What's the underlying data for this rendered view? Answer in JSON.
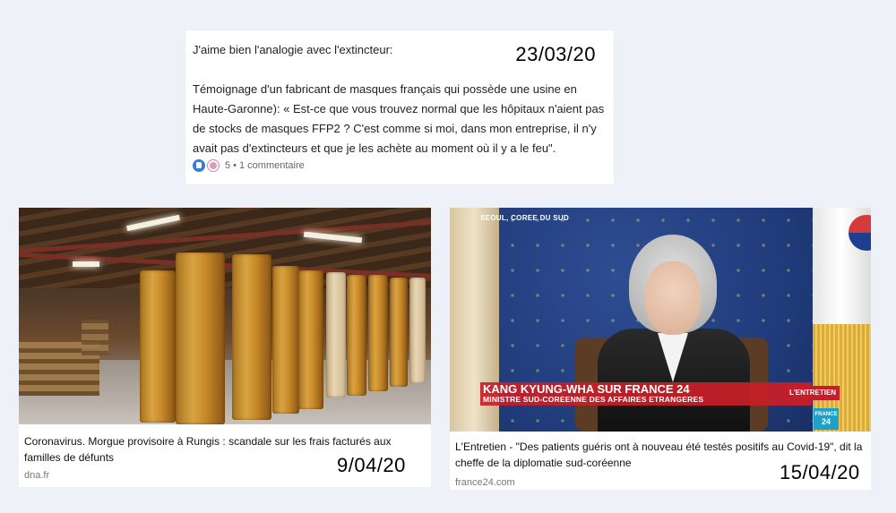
{
  "post": {
    "intro": "J'aime bien l'analogie avec l'extincteur:",
    "date": "23/03/20",
    "body": "Témoignage d'un fabricant de masques français qui possède une usine en Haute-Garonne): « Est-ce que vous trouvez normal que les hôpitaux n'aient pas de stocks de masques FFP2 ? C'est comme si moi, dans mon entreprise, il n'y avait pas d'extincteurs et que je les achète au moment où il y a le feu\".",
    "reaction_count": "5",
    "separator": "•",
    "comments": "1 commentaire",
    "like_icon": "like-icon",
    "support_icon": "support-icon"
  },
  "articles": [
    {
      "caption": "Coronavirus. Morgue provisoire à Rungis : scandale sur les frais facturés aux familles de défunts",
      "source": "dna.fr",
      "date": "9/04/20"
    },
    {
      "caption": "L'Entretien - \"Des patients guéris ont à nouveau été testés positifs au Covid-19\", dit la cheffe de la diplomatie sud-coréenne",
      "source": "france24.com",
      "date": "15/04/20",
      "tv": {
        "location": "SEOUL, COREE DU SUD",
        "name": "KANG KYUNG-WHA SUR FRANCE 24",
        "role": "MINISTRE SUD-COREENNE DES AFFAIRES ETRANGERES",
        "show_tag": "L'ENTRETIEN",
        "logo_line1": "FRANCE",
        "logo_line2": "24"
      }
    }
  ],
  "colors": {
    "background": "#eef2f8",
    "lower_third_red": "#c51d2a",
    "france24_blue": "#1ea1c8",
    "like_blue": "#3a7bd5"
  }
}
